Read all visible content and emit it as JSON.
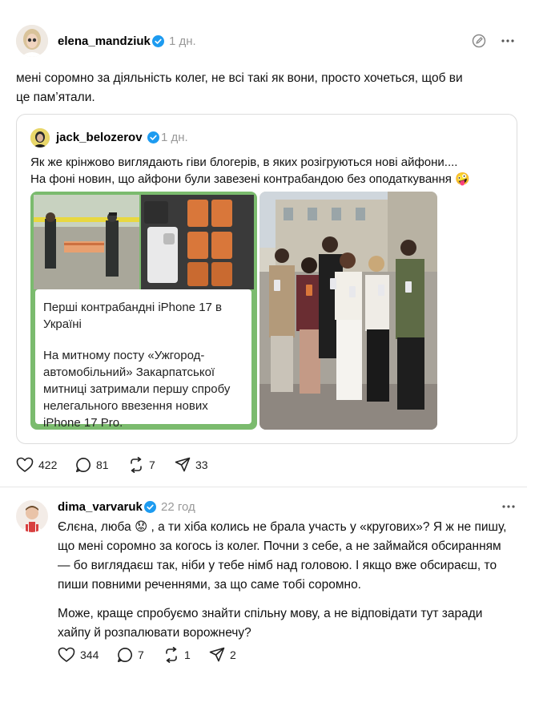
{
  "post": {
    "username": "elena_mandziuk",
    "time": "1 дн.",
    "text_line1": "мені соромно за діяльність колег, не всі такі як вони, просто хочеться, щоб ви",
    "text_line2": "це пам’ятали."
  },
  "quote": {
    "username": "jack_belozerov",
    "time": "1 дн.",
    "text_line1": "Як же крінжово виглядають гіви блогерів, в яких розігруються нові айфони....",
    "text_line2": "На фоні новин, що айфони були завезені контрабандою без оподаткування 🤪",
    "news_title": "Перші контрабандні iPhone 17 в Україні",
    "news_body": "На митному посту «Ужгород-автомобільний» Закарпатської митниці затримали першу спробу нелегального ввезення нових iPhone 17 Pro."
  },
  "post_actions": {
    "likes": "422",
    "comments": "81",
    "reposts": "7",
    "shares": "33"
  },
  "reply": {
    "username": "dima_varvaruk",
    "time": "22 год",
    "p1_line1": "Єлєна, люба 😟 , а ти хіба колись не брала участь у «кругових»? Я ж не пишу,",
    "p1_line2": "що мені соромно за когось із колег. Почни з себе, а не займайся обсиранням",
    "p1_line3": "— бо виглядаєш так, ніби у тебе німб над головою. І якщо вже обсираєш, то",
    "p1_line4": "пиши повними реченнями, за що саме тобі соромно.",
    "p2_line1": "Може, краще спробуємо знайти спільну мову, а не відповідати тут заради",
    "p2_line2": "хайпу й розпалювати ворожнечу?"
  },
  "reply_actions": {
    "likes": "344",
    "comments": "7",
    "reposts": "1",
    "shares": "2"
  },
  "colors": {
    "verified": "#1d9bf0",
    "muted": "#999999",
    "news_green": "#7bbb6e"
  },
  "icons": [
    "verified-icon",
    "compose-icon",
    "more-icon",
    "heart-icon",
    "comment-icon",
    "repost-icon",
    "share-icon"
  ]
}
